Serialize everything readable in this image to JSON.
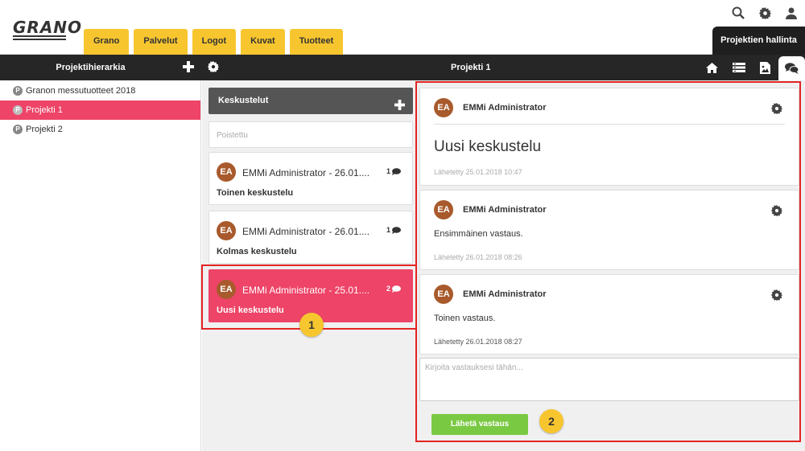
{
  "app": {
    "logo": "GRANO"
  },
  "tabs": [
    {
      "label": "Grano"
    },
    {
      "label": "Palvelut"
    },
    {
      "label": "Logot"
    },
    {
      "label": "Kuvat"
    },
    {
      "label": "Tuotteet"
    }
  ],
  "header": {
    "project_tab": "Projektien hallinta"
  },
  "toolbar": {
    "hierarchy_title": "Projektihierarkia",
    "project_title": "Projekti 1"
  },
  "sidebar": {
    "items": [
      {
        "badge": "P",
        "label": "Granon messutuotteet 2018"
      },
      {
        "badge": "P",
        "label": "Projekti 1"
      },
      {
        "badge": "P",
        "label": "Projekti 2"
      }
    ]
  },
  "conversations": {
    "header": "Keskustelut",
    "filter_value": "Poistettu",
    "items": [
      {
        "avatar": "EA",
        "meta": "EMMi Administrator - 26.01....",
        "count": "1",
        "title": "Toinen keskustelu"
      },
      {
        "avatar": "EA",
        "meta": "EMMi Administrator - 26.01....",
        "count": "1",
        "title": "Kolmas keskustelu"
      },
      {
        "avatar": "EA",
        "meta": "EMMi Administrator - 25.01....",
        "count": "2",
        "title": "Uusi keskustelu"
      }
    ]
  },
  "thread": {
    "main": {
      "avatar": "EA",
      "author": "EMMi Administrator",
      "title": "Uusi keskustelu",
      "date": "Lähetetty 25.01.2018 10:47"
    },
    "replies": [
      {
        "avatar": "EA",
        "author": "EMMi Administrator",
        "text": "Ensimmäinen vastaus.",
        "date": "Lähetetty 26.01.2018 08:26"
      },
      {
        "avatar": "EA",
        "author": "EMMi Administrator",
        "text": "Toinen vastaus.",
        "date": "Lähetetty 26.01.2018 08:27"
      }
    ],
    "reply_placeholder": "Kirjoita vastauksesi tähän...",
    "send_label": "Lähetä vastaus"
  },
  "markers": [
    "1",
    "2"
  ],
  "colors": {
    "accent_pink": "#ed4467",
    "tab_yellow": "#f7c62f",
    "send_green": "#7ac943",
    "highlight_red": "#e32424"
  }
}
